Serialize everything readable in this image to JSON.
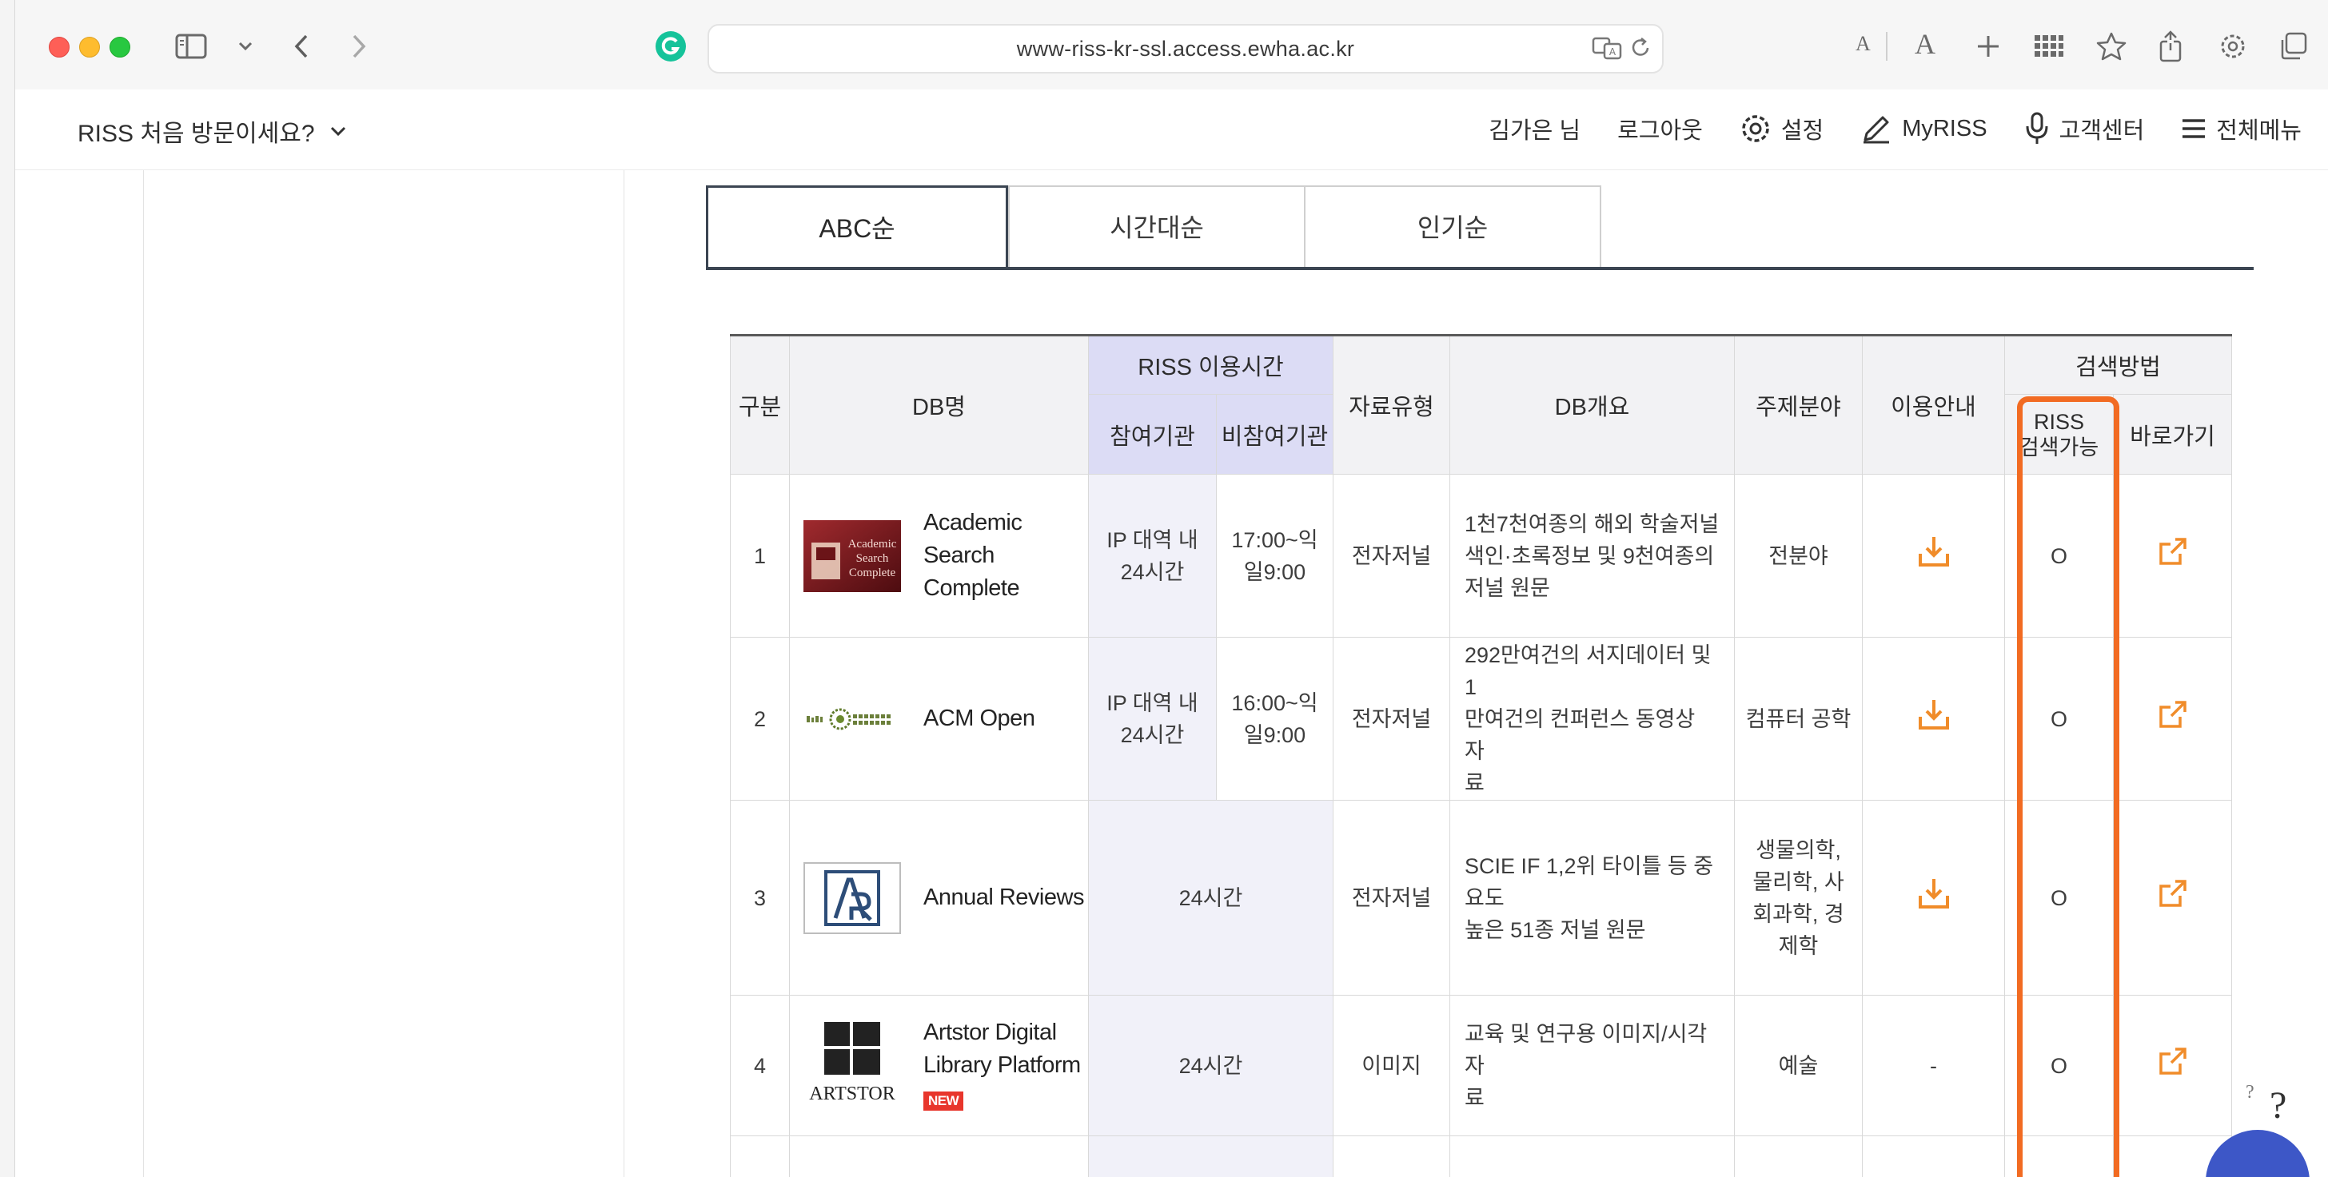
{
  "browser": {
    "url": "www-riss-kr-ssl.access.ewha.ac.kr",
    "font_small": "A",
    "font_large": "A"
  },
  "site_header": {
    "visit_label": "RISS 처음 방문이세요?",
    "user": "김가은 님",
    "logout": "로그아웃",
    "settings": "설정",
    "myriss": "MyRISS",
    "support": "고객센터",
    "menu": "전체메뉴"
  },
  "tabs": [
    {
      "label": "ABC순",
      "active": true
    },
    {
      "label": "시간대순",
      "active": false
    },
    {
      "label": "인기순",
      "active": false
    }
  ],
  "table": {
    "headers": {
      "category": "구분",
      "db_name": "DB명",
      "riss_time": "RISS 이용시간",
      "participating": "참여기관",
      "non_participating": "비참여기관",
      "type": "자료유형",
      "overview": "DB개요",
      "subject": "주제분야",
      "guide": "이용안내",
      "search_method": "검색방법",
      "riss_search_line1": "RISS",
      "riss_search_line2": "검색가능",
      "shortcut": "바로가기"
    },
    "rows": [
      {
        "no": "1",
        "name_line1": "Academic Search",
        "name_line2": "Complete",
        "logo": "academic-search-logo",
        "participating_line1": "IP 대역 내",
        "participating_line2": "24시간",
        "non_participating_line1": "17:00~익",
        "non_participating_line2": "일9:00",
        "type": "전자저널",
        "desc_line1": "1천7천여종의 해외 학술저널",
        "desc_line2": "색인·초록정보 및 9천여종의",
        "desc_line3": "저널 원문",
        "subject_line1": "전분야",
        "guide": "download-icon",
        "riss_search": "O",
        "shortcut": "external-link-icon"
      },
      {
        "no": "2",
        "name_line1": "ACM Open",
        "logo": "acm-digital-library-logo",
        "participating_line1": "IP 대역 내",
        "participating_line2": "24시간",
        "non_participating_line1": "16:00~익",
        "non_participating_line2": "일9:00",
        "type": "전자저널",
        "desc_line1": "292만여건의 서지데이터 및 1",
        "desc_line2": "만여건의 컨퍼런스 동영상 자",
        "desc_line3": "료",
        "subject_line1": "컴퓨터 공학",
        "guide": "download-icon",
        "riss_search": "O",
        "shortcut": "external-link-icon"
      },
      {
        "no": "3",
        "name_line1": "Annual Reviews",
        "logo": "annual-reviews-logo",
        "time": "24시간",
        "type": "전자저널",
        "desc_line1": "SCIE IF 1,2위 타이틀 등 중요도",
        "desc_line2": "높은 51종 저널 원문",
        "subject_line1": "생물의학,",
        "subject_line2": "물리학, 사",
        "subject_line3": "회과학, 경",
        "subject_line4": "제학",
        "guide": "download-icon",
        "riss_search": "O",
        "shortcut": "external-link-icon"
      },
      {
        "no": "4",
        "name_line1": "Artstor Digital",
        "name_line2": "Library Platform",
        "badge": "NEW",
        "logo": "artstor-logo",
        "logo_text": "ARTSTOR",
        "time": "24시간",
        "type": "이미지",
        "desc_line1": "교육 및 연구용 이미지/시각자",
        "desc_line2": "료",
        "subject_line1": "예술",
        "guide": "-",
        "riss_search": "O",
        "shortcut": "external-link-icon"
      }
    ]
  },
  "floating": {
    "help_small": "?",
    "help_large": "?"
  },
  "colors": {
    "accent_orange": "#f26b22",
    "riss_header": "#dcdcf5",
    "time_cell": "#f1f1f9"
  }
}
